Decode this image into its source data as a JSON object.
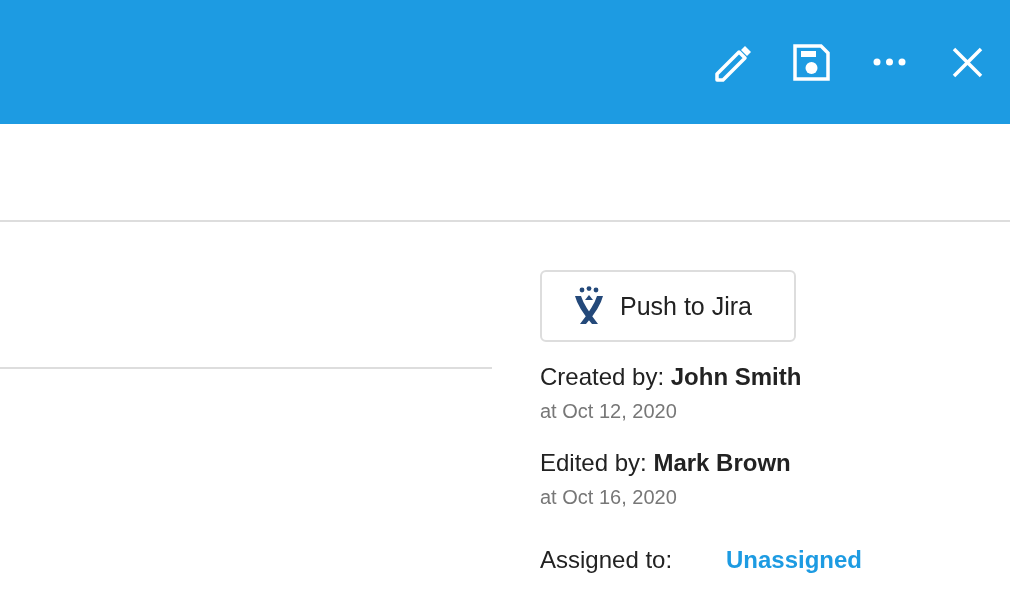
{
  "toolbar": {
    "actions": [
      {
        "kind": "edit"
      },
      {
        "kind": "save"
      },
      {
        "kind": "more"
      },
      {
        "kind": "close"
      }
    ]
  },
  "jira_button": {
    "label": "Push to Jira"
  },
  "history": [
    {
      "text": "Created by: **John Smith**",
      "date": "at Oct 12, 2020"
    },
    {
      "text": "Edited by: **Mark Brown**",
      "date": "at Oct 16, 2020"
    }
  ],
  "assigned": {
    "label": "Assigned to:",
    "value": "Unassigned"
  }
}
